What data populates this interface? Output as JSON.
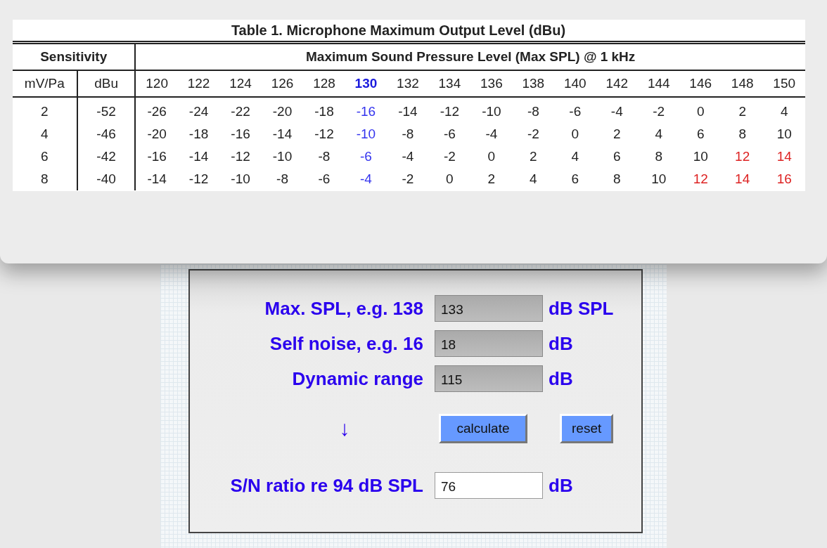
{
  "table": {
    "title": "Table 1. Microphone Maximum Output Level (dBu)",
    "group_headers": [
      "Sensitivity",
      "Maximum Sound Pressure Level (Max SPL) @ 1 kHz"
    ],
    "sensitivity_columns": [
      "mV/Pa",
      "dBu"
    ],
    "spl_columns": [
      {
        "label": "120",
        "selected": false
      },
      {
        "label": "122",
        "selected": false
      },
      {
        "label": "124",
        "selected": false
      },
      {
        "label": "126",
        "selected": false
      },
      {
        "label": "128",
        "selected": false
      },
      {
        "label": "130",
        "selected": true
      },
      {
        "label": "132",
        "selected": false
      },
      {
        "label": "134",
        "selected": false
      },
      {
        "label": "136",
        "selected": false
      },
      {
        "label": "138",
        "selected": false
      },
      {
        "label": "140",
        "selected": false
      },
      {
        "label": "142",
        "selected": false
      },
      {
        "label": "144",
        "selected": false
      },
      {
        "label": "146",
        "selected": false
      },
      {
        "label": "148",
        "selected": false
      },
      {
        "label": "150",
        "selected": false
      }
    ],
    "rows": [
      {
        "sensitivity": "2",
        "dbu": "-52",
        "cells": [
          {
            "text": "-26",
            "exceeds": false
          },
          {
            "text": "-24",
            "exceeds": false
          },
          {
            "text": "-22",
            "exceeds": false
          },
          {
            "text": "-20",
            "exceeds": false
          },
          {
            "text": "-18",
            "exceeds": false
          },
          {
            "text": "-16",
            "exceeds": false
          },
          {
            "text": "-14",
            "exceeds": false
          },
          {
            "text": "-12",
            "exceeds": false
          },
          {
            "text": "-10",
            "exceeds": false
          },
          {
            "text": "-8",
            "exceeds": false
          },
          {
            "text": "-6",
            "exceeds": false
          },
          {
            "text": "-4",
            "exceeds": false
          },
          {
            "text": "-2",
            "exceeds": false
          },
          {
            "text": "0",
            "exceeds": false
          },
          {
            "text": "2",
            "exceeds": false
          },
          {
            "text": "4",
            "exceeds": false
          }
        ]
      },
      {
        "sensitivity": "4",
        "dbu": "-46",
        "cells": [
          {
            "text": "-20",
            "exceeds": false
          },
          {
            "text": "-18",
            "exceeds": false
          },
          {
            "text": "-16",
            "exceeds": false
          },
          {
            "text": "-14",
            "exceeds": false
          },
          {
            "text": "-12",
            "exceeds": false
          },
          {
            "text": "-10",
            "exceeds": false
          },
          {
            "text": "-8",
            "exceeds": false
          },
          {
            "text": "-6",
            "exceeds": false
          },
          {
            "text": "-4",
            "exceeds": false
          },
          {
            "text": "-2",
            "exceeds": false
          },
          {
            "text": "0",
            "exceeds": false
          },
          {
            "text": "2",
            "exceeds": false
          },
          {
            "text": "4",
            "exceeds": false
          },
          {
            "text": "6",
            "exceeds": false
          },
          {
            "text": "8",
            "exceeds": false
          },
          {
            "text": "10",
            "exceeds": false
          }
        ]
      },
      {
        "sensitivity": "6",
        "dbu": "-42",
        "cells": [
          {
            "text": "-16",
            "exceeds": false
          },
          {
            "text": "-14",
            "exceeds": false
          },
          {
            "text": "-12",
            "exceeds": false
          },
          {
            "text": "-10",
            "exceeds": false
          },
          {
            "text": "-8",
            "exceeds": false
          },
          {
            "text": "-6",
            "exceeds": false
          },
          {
            "text": "-4",
            "exceeds": false
          },
          {
            "text": "-2",
            "exceeds": false
          },
          {
            "text": "0",
            "exceeds": false
          },
          {
            "text": "2",
            "exceeds": false
          },
          {
            "text": "4",
            "exceeds": false
          },
          {
            "text": "6",
            "exceeds": false
          },
          {
            "text": "8",
            "exceeds": false
          },
          {
            "text": "10",
            "exceeds": false
          },
          {
            "text": "12",
            "exceeds": true
          },
          {
            "text": "14",
            "exceeds": true
          }
        ]
      },
      {
        "sensitivity": "8",
        "dbu": "-40",
        "cells": [
          {
            "text": "-14",
            "exceeds": false
          },
          {
            "text": "-12",
            "exceeds": false
          },
          {
            "text": "-10",
            "exceeds": false
          },
          {
            "text": "-8",
            "exceeds": false
          },
          {
            "text": "-6",
            "exceeds": false
          },
          {
            "text": "-4",
            "exceeds": false
          },
          {
            "text": "-2",
            "exceeds": false
          },
          {
            "text": "0",
            "exceeds": false
          },
          {
            "text": "2",
            "exceeds": false
          },
          {
            "text": "4",
            "exceeds": false
          },
          {
            "text": "6",
            "exceeds": false
          },
          {
            "text": "8",
            "exceeds": false
          },
          {
            "text": "10",
            "exceeds": false
          },
          {
            "text": "12",
            "exceeds": true
          },
          {
            "text": "14",
            "exceeds": true
          },
          {
            "text": "16",
            "exceeds": true
          }
        ]
      }
    ]
  },
  "calculator": {
    "inputs": [
      {
        "label": "Max. SPL, e.g. 138",
        "value": "133",
        "unit": "dB SPL",
        "shaded": true
      },
      {
        "label": "Self noise, e.g. 16",
        "value": "18",
        "unit": "dB",
        "shaded": true
      },
      {
        "label": "Dynamic range",
        "value": "115",
        "unit": "dB",
        "shaded": true
      }
    ],
    "arrow": "↓",
    "buttons": [
      "calculate",
      "reset"
    ],
    "result": {
      "label": "S/N ratio re 94 dB SPL",
      "value": "76",
      "unit": "dB",
      "shaded": false
    }
  }
}
